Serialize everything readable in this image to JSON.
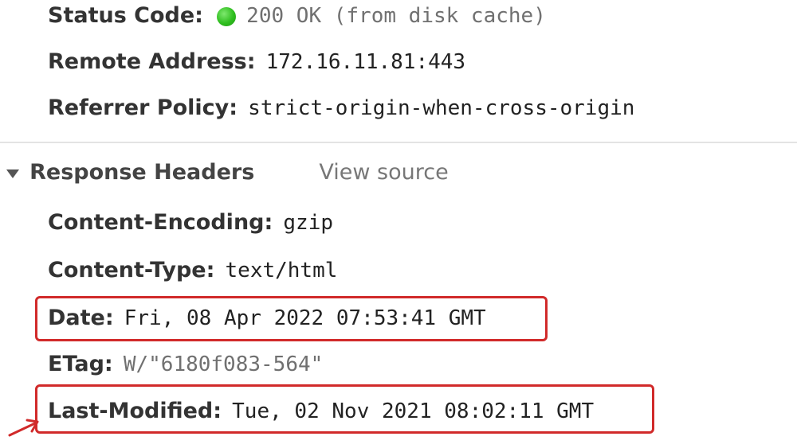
{
  "general": {
    "status_code_key": "Status Code:",
    "status_code_val": "200 OK (from disk cache)",
    "remote_address_key": "Remote Address:",
    "remote_address_val": "172.16.11.81:443",
    "referrer_policy_key": "Referrer Policy:",
    "referrer_policy_val": "strict-origin-when-cross-origin"
  },
  "response_headers": {
    "title": "Response Headers",
    "view_source": "View source",
    "items": [
      {
        "key": "Content-Encoding:",
        "val": "gzip"
      },
      {
        "key": "Content-Type:",
        "val": "text/html"
      },
      {
        "key": "Date:",
        "val": "Fri, 08 Apr 2022 07:53:41 GMT"
      },
      {
        "key": "ETag:",
        "val": "W/\"6180f083-564\""
      },
      {
        "key": "Last-Modified:",
        "val": "Tue, 02 Nov 2021 08:02:11 GMT"
      }
    ]
  },
  "colors": {
    "status_ok": "#2fbe1f",
    "highlight": "#d12a2a"
  }
}
